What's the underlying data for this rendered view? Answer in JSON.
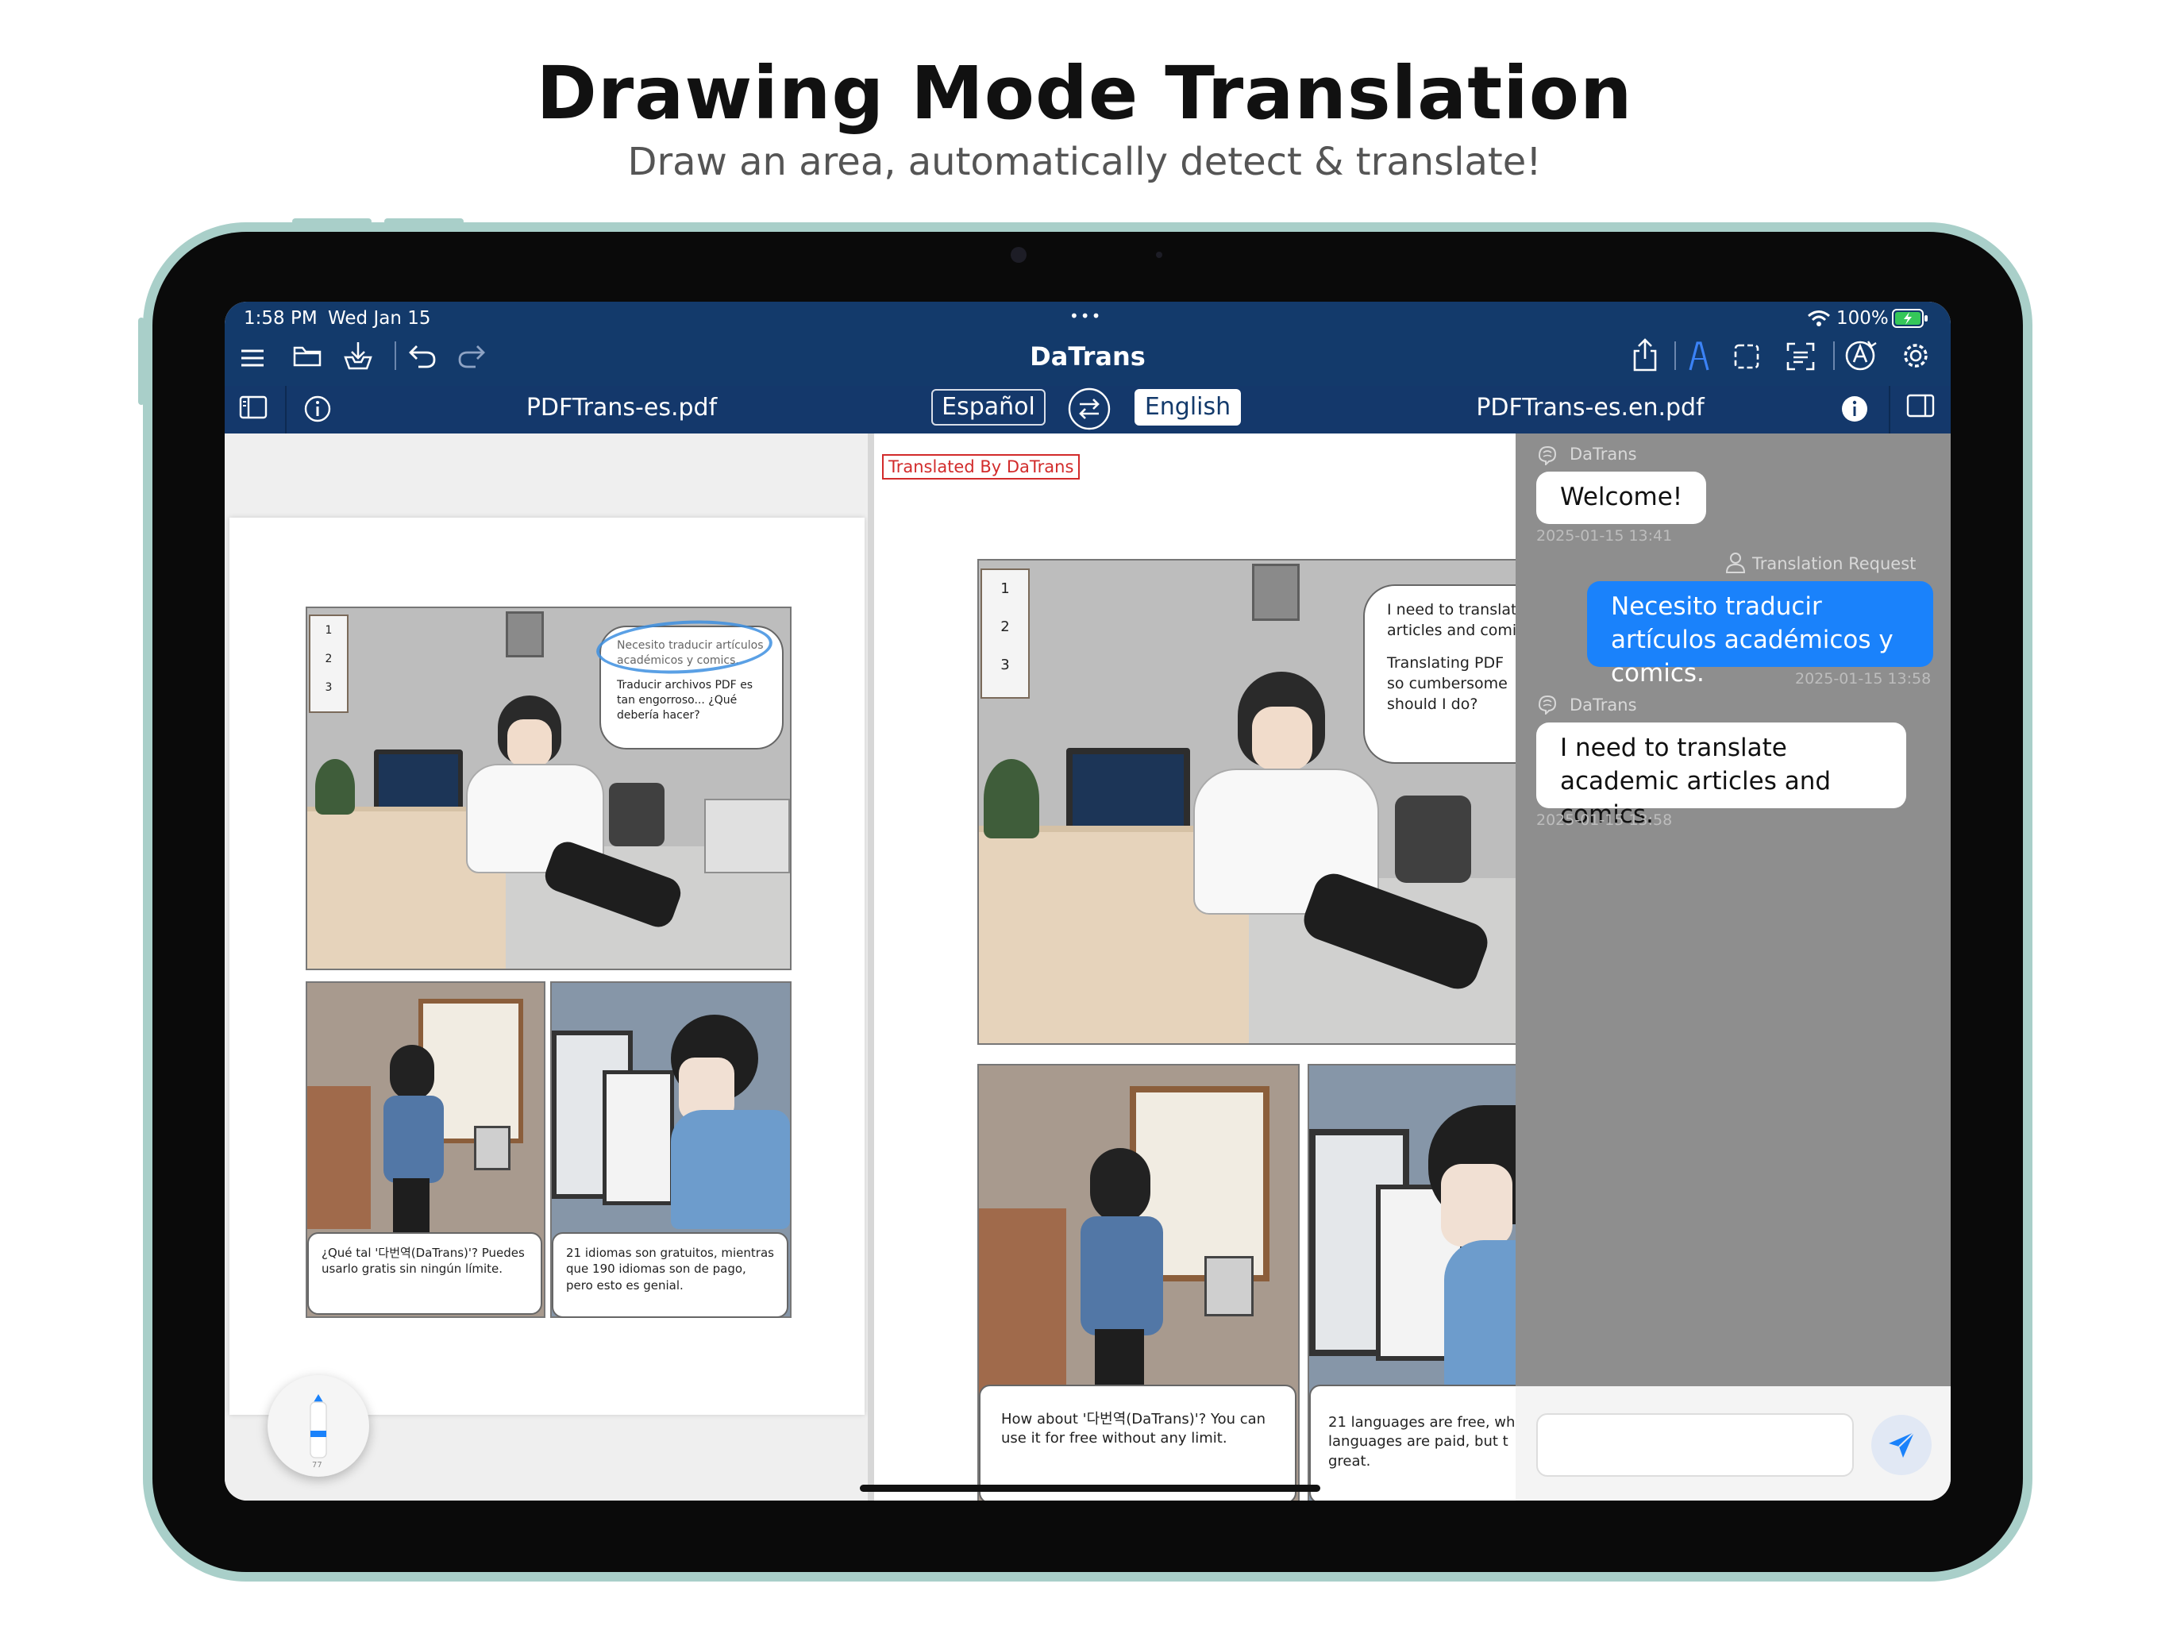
{
  "marketing": {
    "headline": "Drawing Mode Translation",
    "subline": "Draw an area, automatically detect & translate!"
  },
  "status": {
    "time": "1:58 PM",
    "date": "Wed Jan 15",
    "battery": "100%"
  },
  "app": {
    "title": "DaTrans",
    "toolbar_icons": [
      "menu-icon",
      "folder-icon",
      "import-icon",
      "undo-icon",
      "redo-icon",
      "share-icon",
      "pen-icon",
      "selection-icon",
      "scan-text-icon",
      "ai-translate-icon",
      "gear-icon"
    ]
  },
  "tabs": {
    "source_file": "PDFTrans-es.pdf",
    "source_lang": "Español",
    "target_lang": "English",
    "target_file": "PDFTrans-es.en.pdf"
  },
  "source_page": {
    "bubble_highlight": "Necesito traducir artículos académicos y comics.",
    "bubble_rest": "Traducir archivos PDF es tan engorroso... ¿Qué debería hacer?",
    "calendar": [
      "1",
      "2",
      "3"
    ],
    "caption_left": "¿Qué tal '다번역(DaTrans)'? Puedes usarlo gratis sin ningún límite.",
    "caption_right": "21 idiomas son gratuitos, mientras que 190 idiomas son de pago, pero esto es genial."
  },
  "translated_page": {
    "stamp": "Translated By DaTrans",
    "bubble_line1": "I need to translat",
    "bubble_line2": "articles and comi",
    "bubble_line3": "Translating PDF",
    "bubble_line4": "so cumbersome",
    "bubble_line5": "should I do?",
    "calendar": [
      "1",
      "2",
      "3"
    ],
    "caption_left": "How about '다번역(DaTrans)'? You can use it for free without any limit.",
    "caption_right": "21 languages are free, wh languages are paid, but t great."
  },
  "chat": {
    "messages": [
      {
        "sender": "DaTrans",
        "text": "Welcome!",
        "time": "2025-01-15 13:41"
      },
      {
        "sender": "Translation Request",
        "text": "Necesito traducir artículos académicos y comics.",
        "time": "2025-01-15 13:58"
      },
      {
        "sender": "DaTrans",
        "text": "I need to translate academic articles and comics.",
        "time": "2025-01-15 13:58"
      }
    ],
    "input_placeholder": ""
  },
  "floating_tool": {
    "label": "77"
  },
  "colors": {
    "nav_bg": "#133a6b",
    "user_bubble": "#1a82fb",
    "chat_bg": "#8e8e8e",
    "stamp_red": "#d22b2b",
    "highlight_blue": "#3d8fe0"
  }
}
